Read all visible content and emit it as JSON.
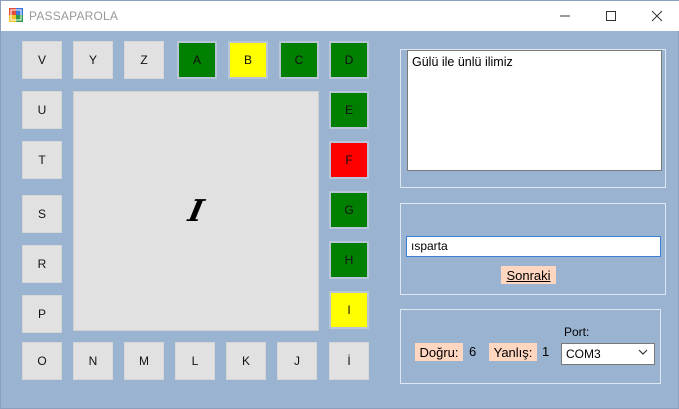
{
  "window": {
    "title": "PASSAPAROLA"
  },
  "letters": {
    "V": "V",
    "Y": "Y",
    "Z": "Z",
    "A": "A",
    "B": "B",
    "C": "C",
    "D": "D",
    "E": "E",
    "F": "F",
    "G": "G",
    "H": "H",
    "I": "I",
    "U": "U",
    "T": "T",
    "S": "S",
    "R": "R",
    "P": "P",
    "O": "O",
    "N": "N",
    "M": "M",
    "L": "L",
    "K": "K",
    "J": "J",
    "Idot": "İ"
  },
  "status_colors": {
    "correct": "#007f00",
    "current": "#ffff00",
    "wrong": "#ff0000",
    "unanswered": "#e1e1e1"
  },
  "center": {
    "current_letter": "I"
  },
  "question": {
    "text": "Gülü ile ünlü ilimiz"
  },
  "answer": {
    "value": "ısparta",
    "next_label": "Sonraki"
  },
  "score": {
    "correct_label": "Doğru:",
    "correct_value": "6",
    "wrong_label": "Yanlış:",
    "wrong_value": "1"
  },
  "port": {
    "label": "Port:",
    "selected": "COM3"
  }
}
